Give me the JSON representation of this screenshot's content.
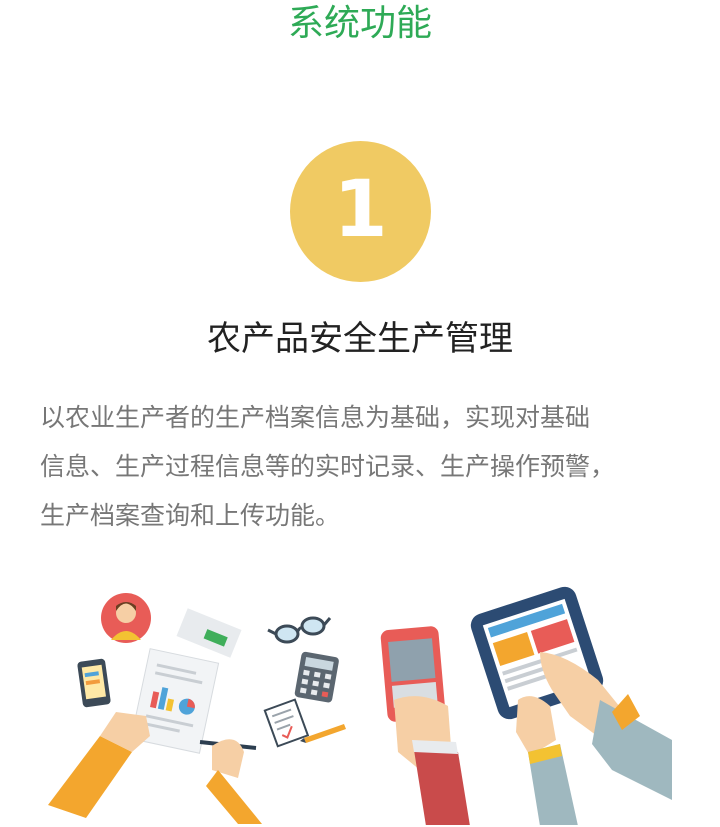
{
  "page": {
    "title": "系统功能"
  },
  "feature": {
    "number": "1",
    "title": "农产品安全生产管理",
    "description_lines": [
      "以农业生产者的生产档案信息为基础，实现对基础",
      "信息、生产过程信息等的实时记录、生产操作预警，",
      "生产档案查询和上传功能。"
    ]
  },
  "illustration": {
    "icons": [
      "farmer-avatar-icon",
      "smartphone-icon",
      "report-document-icon",
      "glasses-icon",
      "calculator-icon",
      "checklist-icon",
      "pencil-icon",
      "pen-icon",
      "phone-keyboard-icon",
      "tablet-icon"
    ]
  },
  "colors": {
    "title_green": "#2eaa56",
    "badge_yellow": "#f0ca63",
    "text_dark": "#222222",
    "text_gray": "#777777"
  }
}
